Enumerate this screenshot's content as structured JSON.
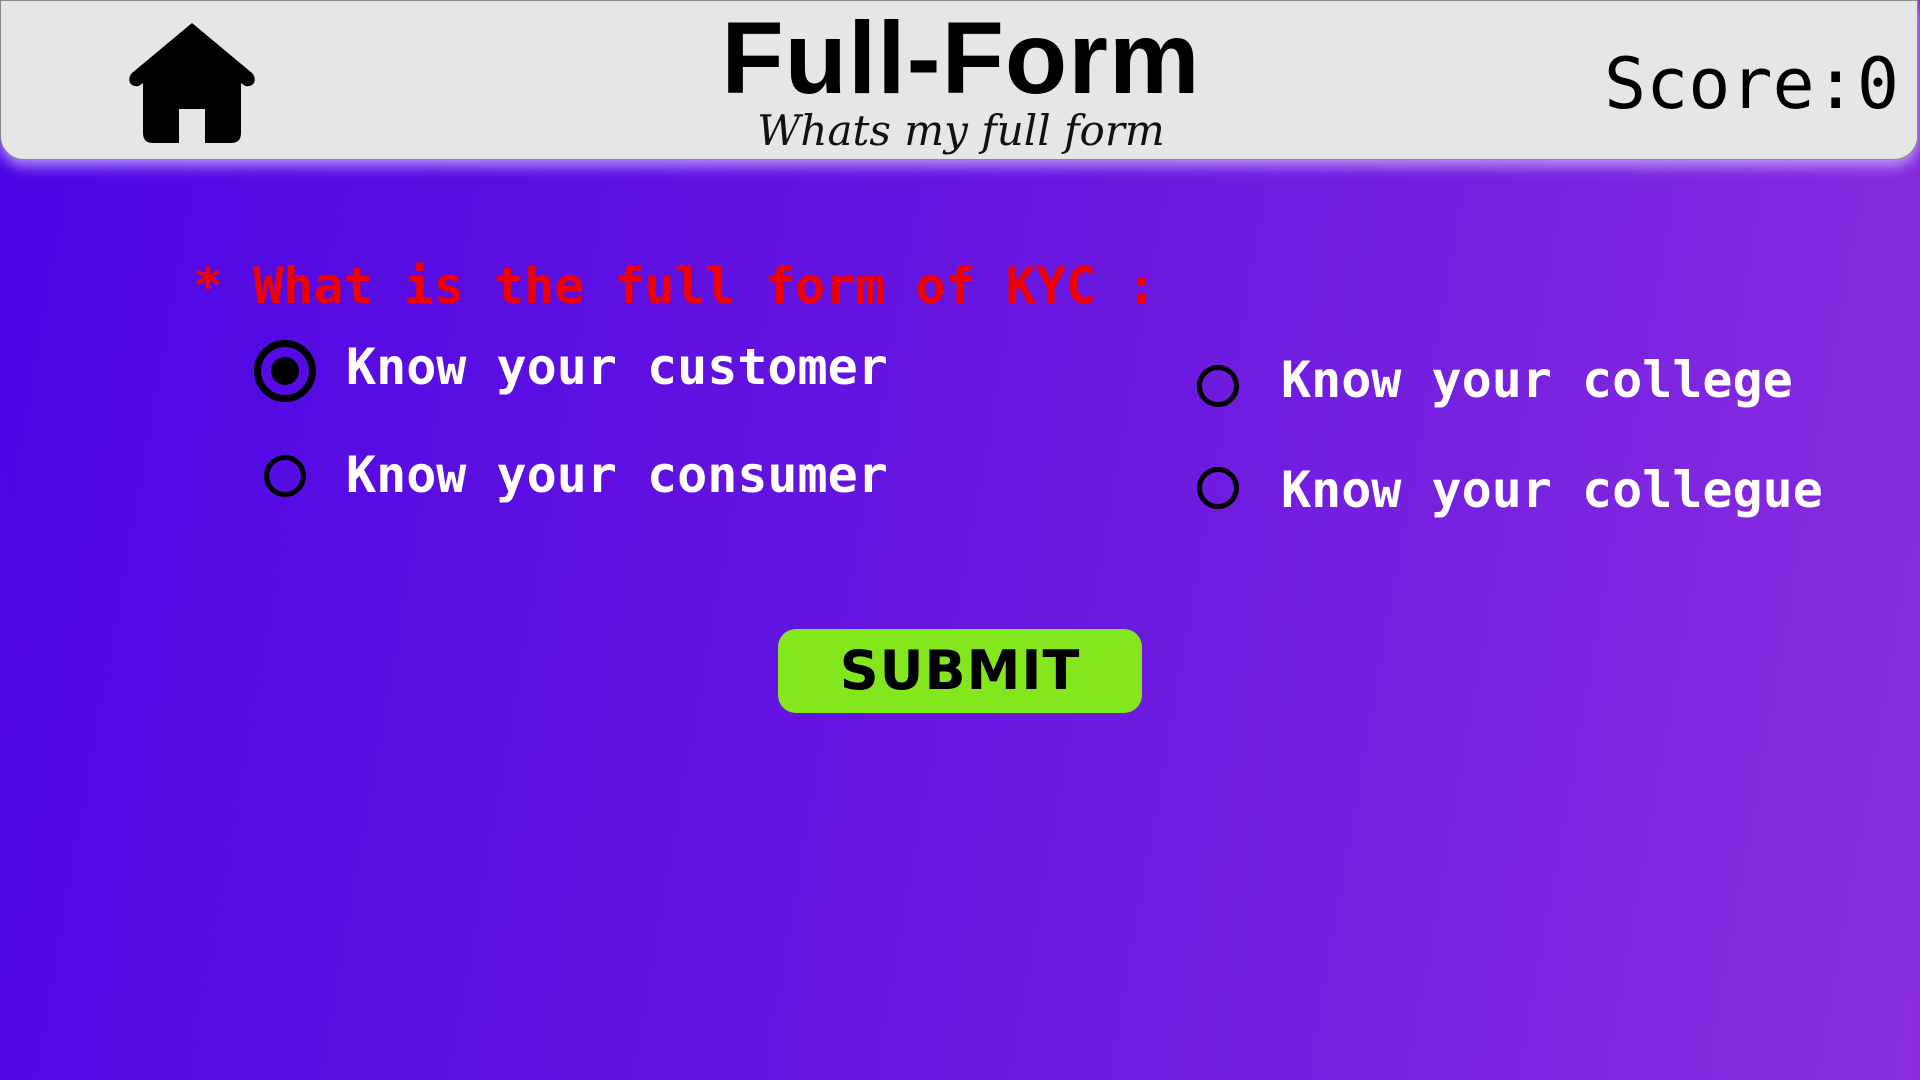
{
  "header": {
    "title": "Full-Form",
    "subtitle": "Whats my full form",
    "score_label": "Score:",
    "score_value": "0",
    "home_icon": "home-icon"
  },
  "quiz": {
    "question": "* What is the full form of KYC :",
    "options": [
      {
        "label": "Know your customer",
        "selected": true
      },
      {
        "label": "Know your college",
        "selected": false
      },
      {
        "label": "Know your consumer",
        "selected": false
      },
      {
        "label": "Know your collegue",
        "selected": false
      }
    ],
    "submit_label": "SUBMIT"
  },
  "colors": {
    "header_bg": "#e6e6e6",
    "background_start": "#4c05e4",
    "background_end": "#8a2ee0",
    "question_text": "#f20000",
    "option_text": "#ffffff",
    "submit_bg": "#84e61c"
  }
}
